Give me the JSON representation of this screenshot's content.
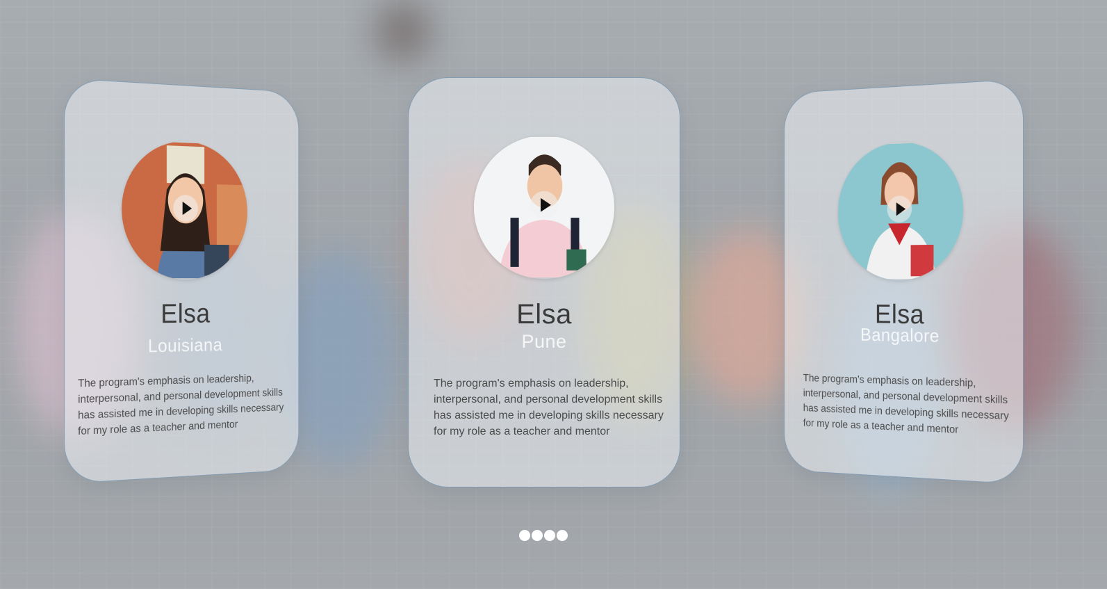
{
  "testimonials": [
    {
      "name": "Elsa",
      "location": "Louisiana",
      "quote": "The program's emphasis on leadership, interpersonal, and personal development skills has assisted me in developing skills necessary for my role as a teacher and mentor",
      "avatar_bg": "#c96a44",
      "play_icon": "play-icon"
    },
    {
      "name": "Elsa",
      "location": "Pune",
      "quote": "The program's emphasis on leadership, interpersonal, and personal development skills has assisted me in developing skills necessary for my role as a teacher and mentor",
      "avatar_bg": "#f2f4f6",
      "play_icon": "play-icon"
    },
    {
      "name": "Elsa",
      "location": "Bangalore",
      "quote": "The program's emphasis on leadership, interpersonal, and personal development skills has assisted me in developing skills necessary for my role as a teacher and mentor",
      "avatar_bg": "#8cc6cf",
      "play_icon": "play-icon"
    }
  ],
  "pagination": {
    "count": 4,
    "color": "#ffffff"
  },
  "colors": {
    "card_border": "#5c80a0",
    "name_text": "#3b3b3b",
    "location_text": "#ffffff",
    "quote_text": "#4b4b4b"
  }
}
